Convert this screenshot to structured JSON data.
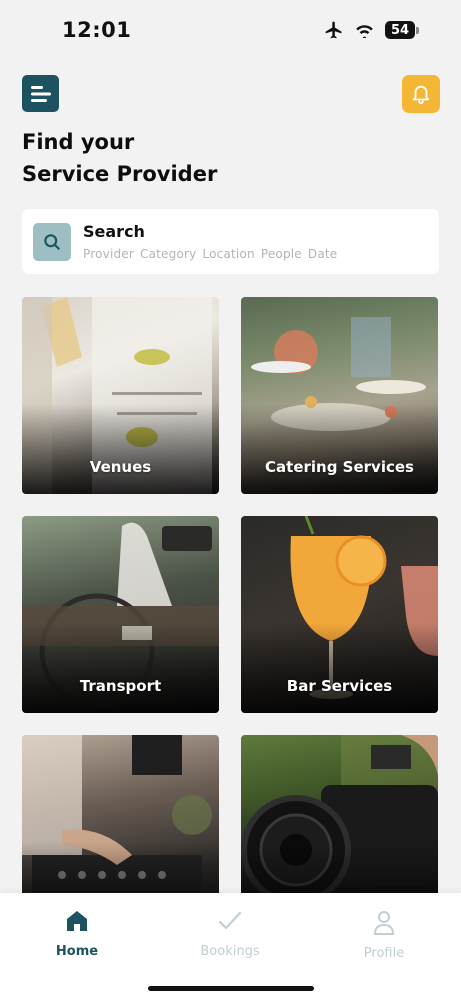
{
  "status_bar": {
    "time": "12:01",
    "battery": "54"
  },
  "header": {
    "title_line1": "Find your",
    "title_line2": "Service Provider"
  },
  "search": {
    "title": "Search",
    "subtitle": "Provider Category  Location  People  Date"
  },
  "categories": [
    {
      "label": "Venues"
    },
    {
      "label": "Catering Services"
    },
    {
      "label": "Transport"
    },
    {
      "label": "Bar Services"
    },
    {
      "label": ""
    },
    {
      "label": ""
    }
  ],
  "nav": {
    "home": "Home",
    "bookings": "Bookings",
    "profile": "Profile"
  },
  "colors": {
    "primary": "#1d5360",
    "accent": "#f4b635",
    "search_icon_bg": "#9dbfc4",
    "inactive_nav": "#bfcfd2"
  },
  "icons": {
    "menu": "menu-icon",
    "bell": "bell-icon",
    "search": "search-icon",
    "home": "home-icon",
    "bookings": "checkmark-icon",
    "profile": "user-icon"
  }
}
